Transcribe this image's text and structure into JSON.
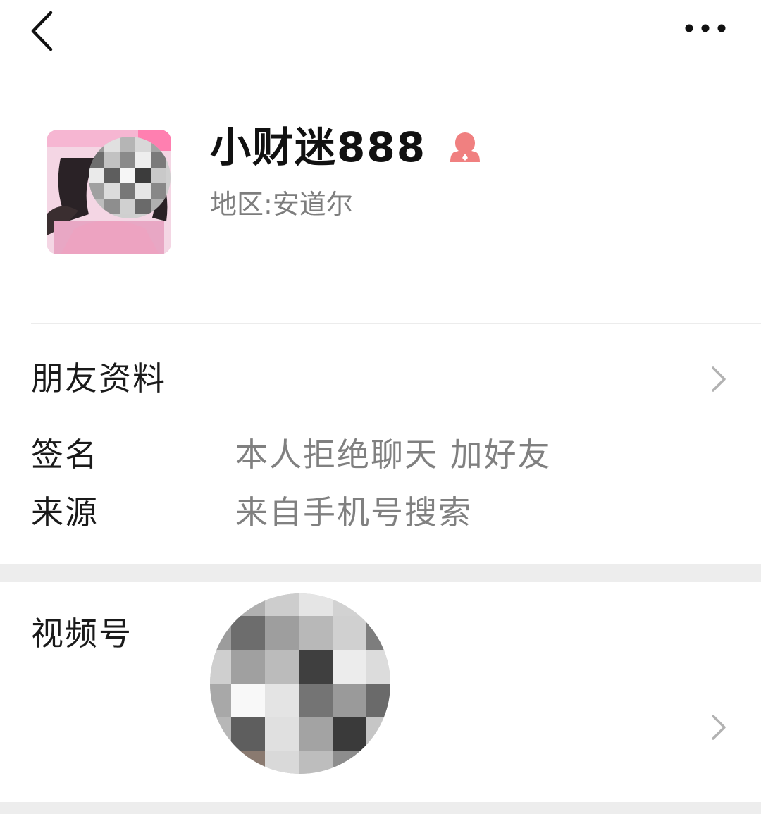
{
  "header": {
    "back_icon": "chevron-left-icon",
    "more_icon": "more-horizontal-icon"
  },
  "profile": {
    "nickname": "小财迷888",
    "gender_icon": "female-user-icon",
    "region": "地区:安道尔",
    "accent_color": "#f08080"
  },
  "friend_profile": {
    "label": "朋友资料"
  },
  "details": {
    "signature_label": "签名",
    "signature_value": "本人拒绝聊天 加好友",
    "source_label": "来源",
    "source_value": "来自手机号搜索"
  },
  "channels": {
    "label": "视频号"
  },
  "colors": {
    "label": "#1a1a1a",
    "secondary": "#808080",
    "separator": "#ededed"
  }
}
